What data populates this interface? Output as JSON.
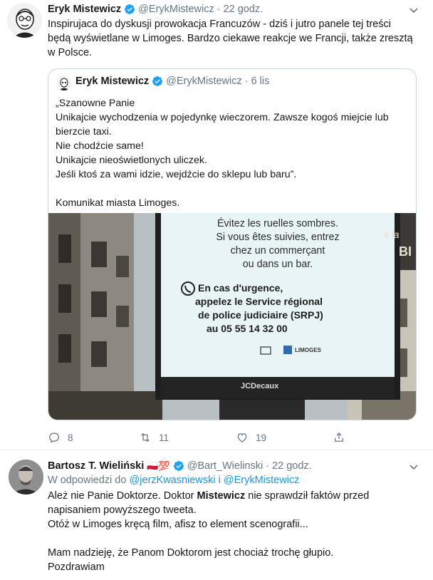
{
  "tweets": [
    {
      "author_name": "Eryk Mistewicz",
      "handle": "@ErykMistewicz",
      "separator": "·",
      "time": "22 godz.",
      "text_lines": [
        "Inspirujaca do dyskusji prowokacja Francuzów - dziś i jutro panele tej treści",
        "będą wyświetlane w Limoges. Bardzo ciekawe reakcje we Francji, także zresztą",
        "w Polsce."
      ],
      "quoted": {
        "author_name": "Eryk Mistewicz",
        "handle": "@ErykMistewicz",
        "separator": "·",
        "time": "6 lis",
        "text_lines": [
          "„Szanowne Panie",
          "Unikajcie wychodzenia w pojedynkę wieczorem. Zawsze kogoś miejcie lub",
          "bierzcie taxi.",
          "Nie chodźcie same!",
          "Unikajcie nieoświetlonych uliczek.",
          "Jeśli ktoś za wami idzie, wejdźcie do sklepu lub baru”.",
          "",
          "Komunikat miasta Limoges."
        ],
        "photo": {
          "sign_lines": [
            "Évitez les ruelles sombres.",
            "Si vous êtes suivies, entrez",
            "chez un commerçant",
            "ou dans un bar."
          ],
          "sign_urgent_lines": [
            "En cas d'urgence,",
            "appelez le Service régional",
            "de police judiciaire (SRPJ)",
            "au 05 55 14 32 00"
          ],
          "sign_logo_text": "LIMOGES",
          "billboard_brand": "JCDecaux",
          "shop_sign_1": "à la",
          "shop_sign_2": "BI"
        }
      },
      "actions": {
        "replies": "8",
        "retweets": "11",
        "likes": "19"
      }
    },
    {
      "author_name": "Bartosz T. Wieliński",
      "emoji": "🇵🇱💯",
      "handle": "@Bart_Wielinski",
      "separator": "·",
      "time": "22 godz.",
      "reply_prefix": "W odpowiedzi do",
      "reply_mention_1": "@jerzKwasniewski",
      "reply_and": "i",
      "reply_mention_2": "@ErykMistewicz",
      "text_line1_pre": "Ależ nie Panie Doktorze. Doktor",
      "text_line1_bold": "Mistewicz",
      "text_line1_post": "nie sprawdził faktów przed",
      "text_lines_rest": [
        "napisaniem powyższego tweeta.",
        "Otóż w Limoges kręcą film, afisz to element scenografii...",
        "",
        "Mam nadzieję, że Panom Doktorom jest chociaż trochę głupio.",
        "Pozdrawiam"
      ]
    }
  ],
  "colors": {
    "accent": "#1da1f2",
    "secondary_text": "#657786",
    "mention": "#1b95e0",
    "border": "#e6ecf0"
  }
}
